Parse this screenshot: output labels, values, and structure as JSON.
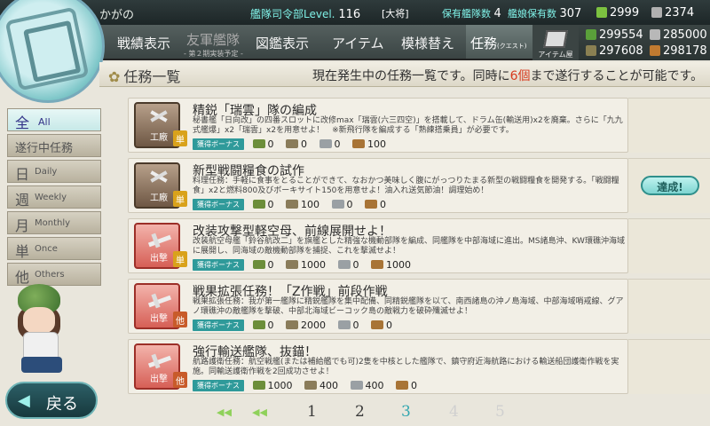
{
  "top": {
    "admiral_name": "かがの",
    "hq_label": "艦隊司令部Level.",
    "hq_level": "116",
    "rank": "[大将]",
    "ships_label": "保有艦隊数",
    "ships_count": "4",
    "equip_label": "艦娘保有数",
    "equip_count": "307",
    "buckets": "2999",
    "devmats": "2374"
  },
  "nav": {
    "record": "戦績表示",
    "fleet": "友軍艦隊",
    "fleet_note": "- 第２期実装予定 -",
    "library": "図鑑表示",
    "items": "アイテム",
    "remodel": "模様替え",
    "quest": "任務",
    "quest_small": "(クエスト)",
    "item_shop": "アイテム屋"
  },
  "resources": {
    "fuel": "299554",
    "steel": "285000",
    "ammo": "297608",
    "bauxite": "298178"
  },
  "header": {
    "title": "任務一覧",
    "msg_pre": "現在発生中の任務一覧です。同時に",
    "msg_num": "6個",
    "msg_post": "まで遂行することが可能です。"
  },
  "sidebar": [
    {
      "k": "全",
      "e": "All"
    },
    {
      "k": "遂行中任務",
      "e": ""
    },
    {
      "k": "日",
      "e": "Daily"
    },
    {
      "k": "週",
      "e": "Weekly"
    },
    {
      "k": "月",
      "e": "Monthly"
    },
    {
      "k": "単",
      "e": "Once"
    },
    {
      "k": "他",
      "e": "Others"
    }
  ],
  "bonus_label": "獲得ボーナス",
  "quests": [
    {
      "icon_label": "工廠",
      "tag": "単",
      "title": "精鋭「瑞雲」隊の編成",
      "desc": "秘書艦「日向改」の四番スロットに改修max「瑞雲(六三四空)」を搭載して、ドラム缶(輸送用)x2を廃棄。さらに「九九式艦爆」x2「瑞雲」x2を用意せよ！　※新飛行隊を編成する「熟練搭乗員」が必要です。",
      "rewards": [
        "0",
        "0",
        "0",
        "100"
      ]
    },
    {
      "icon_label": "工廠",
      "tag": "単",
      "title": "新型戦闘糧食の試作",
      "desc": "料理任務：手軽に食事をとることができて、なおかつ美味しく腹にがっつりたまる新型の戦闘糧食を開発する。「戦闘糧食」x2と燃料800及びボーキサイト150を用意せよ！油入れ送気節油！調理始め！",
      "rewards": [
        "0",
        "100",
        "0",
        "0"
      ]
    },
    {
      "icon_label": "出撃",
      "tag": "単",
      "title": "改装攻撃型軽空母、前線展開せよ！",
      "desc": "改装航空母艦「鈴谷航改二」を旗艦とした精強な機動部隊を編成、同艦隊を中部海域に進出。MS諸島沖、KW環礁沖海域に展開し、同海域の敵機動部隊を捕捉、これを撃滅せよ！",
      "rewards": [
        "0",
        "1000",
        "0",
        "1000"
      ]
    },
    {
      "icon_label": "出撃",
      "tag": "他",
      "title": "戦果拡張任務！「Z作戦」前段作戦",
      "desc": "戦果拡張任務：我が第一艦隊に精鋭艦隊を集中配備、同精鋭艦隊を以て、南西諸島の沖ノ島海域、中部海域哨戒線、グアノ環礁沖の敵艦隊を撃破、中部北海域ビーコック島の敵戦力を破砕殲滅せよ！",
      "rewards": [
        "0",
        "2000",
        "0",
        "0"
      ]
    },
    {
      "icon_label": "出撃",
      "tag": "他",
      "title": "強行輸送艦隊、抜錨！",
      "desc": "航路護衛任務：航空戦艦(または補給艦でも可)2隻を中核とした艦隊で、鎮守府近海航路における輸送船団護衛作戦を実施。同輸送護衛作戦を2回成功させよ！",
      "rewards": [
        "1000",
        "400",
        "400",
        "0"
      ]
    }
  ],
  "done_badge": "達成!",
  "back_label": "戻る",
  "pager": {
    "pages": [
      "1",
      "2",
      "3",
      "4",
      "5"
    ],
    "current": "3"
  }
}
